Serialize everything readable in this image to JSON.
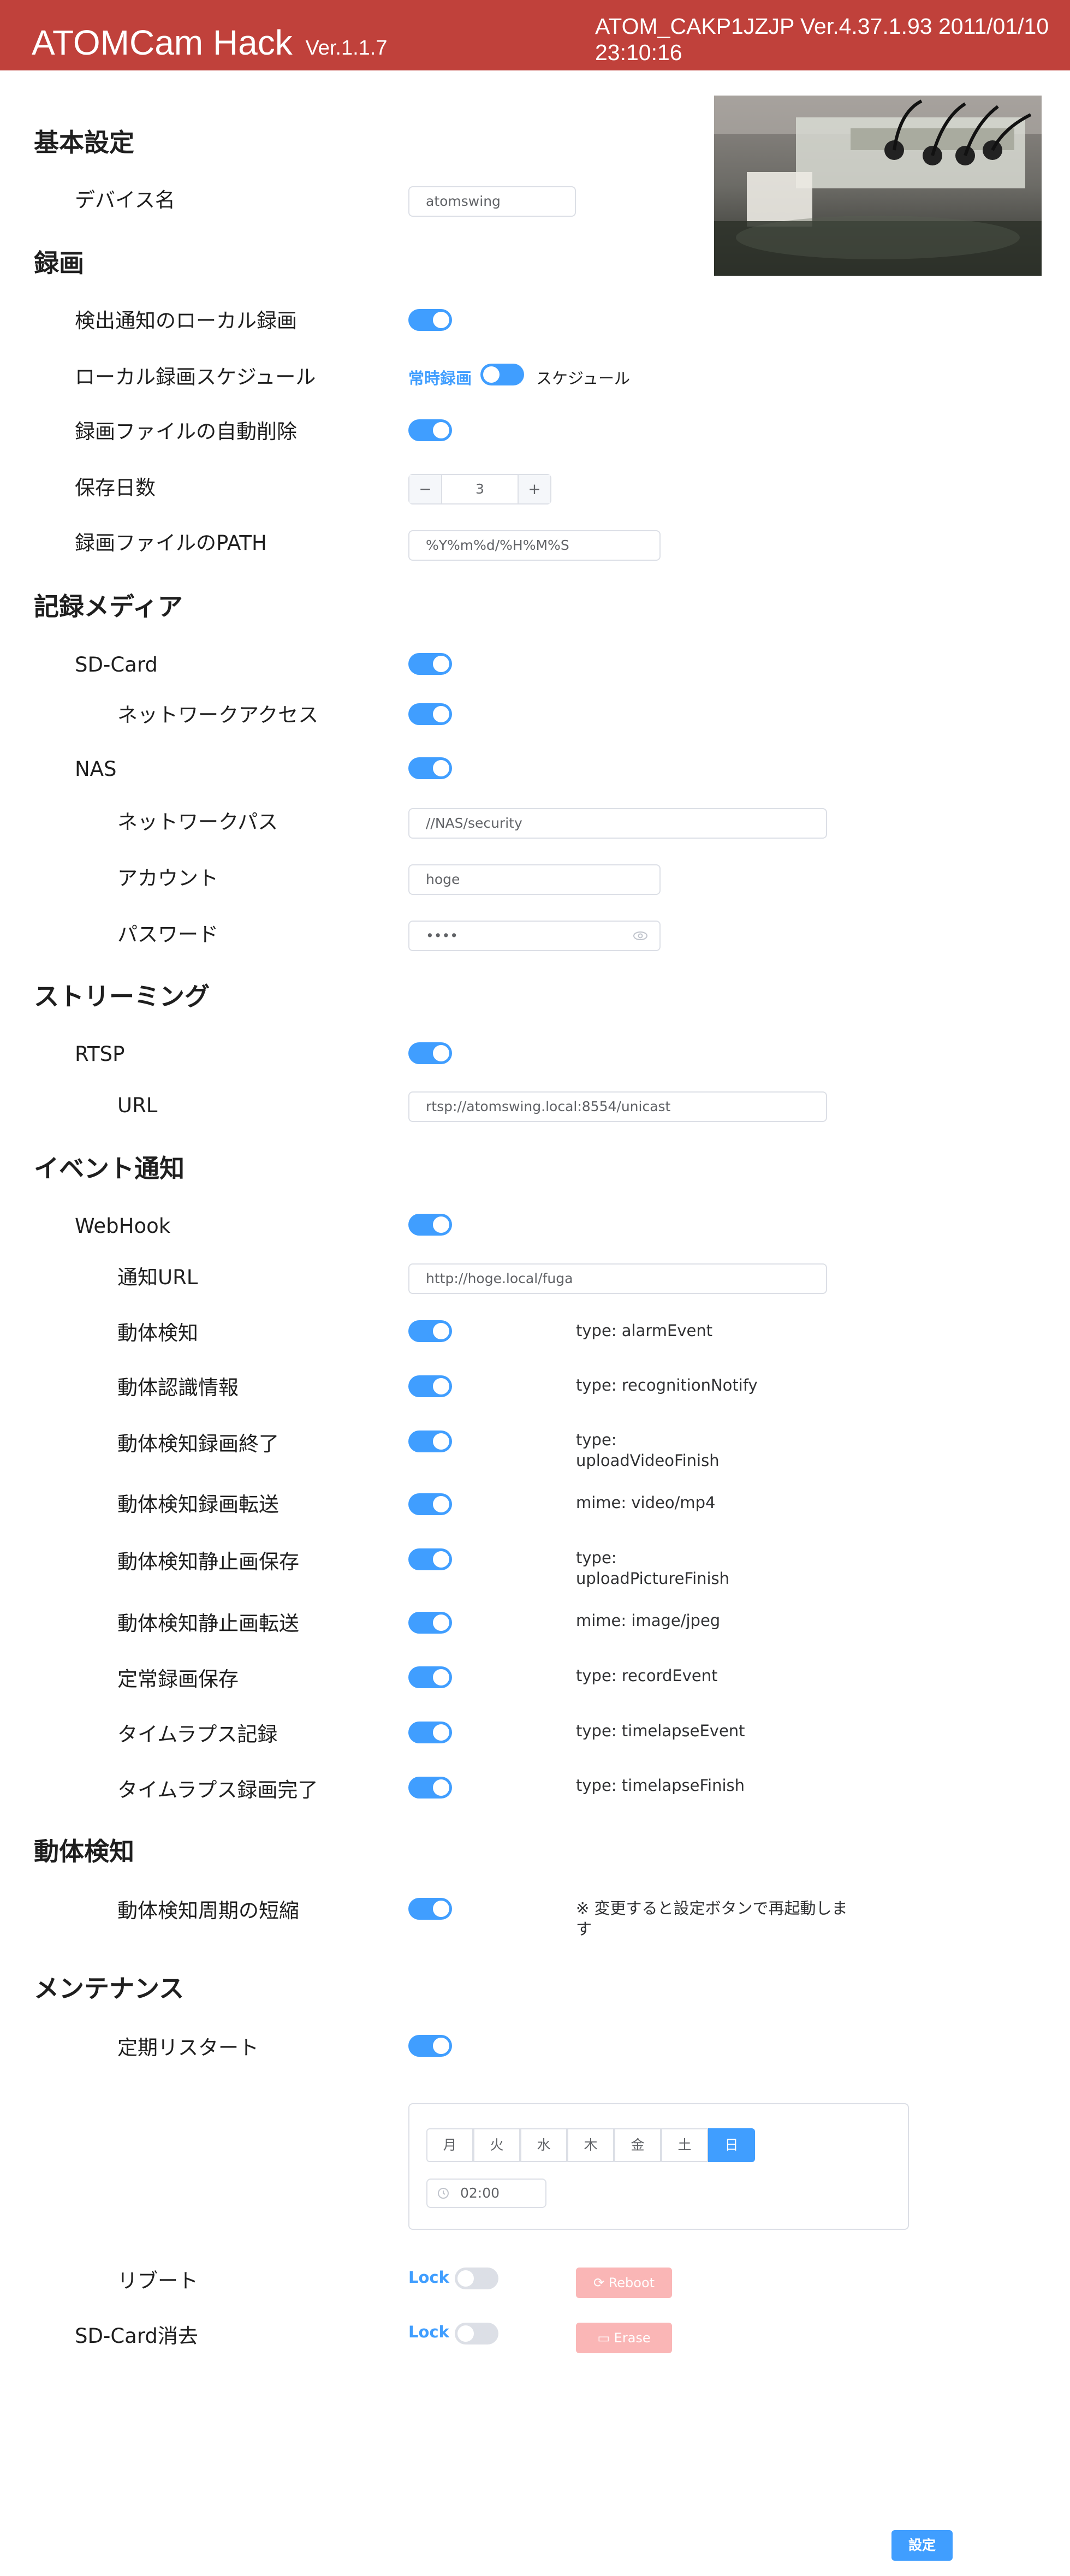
{
  "header": {
    "title": "ATOMCam Hack",
    "version": "Ver.1.1.7",
    "device_info": "ATOM_CAKP1JZJP Ver.4.37.1.93 2011/01/10 23:10:16"
  },
  "basic": {
    "section": "基本設定",
    "device_name_label": "デバイス名",
    "device_name_value": "atomswing"
  },
  "recording": {
    "section": "録画",
    "detect_local_label": "検出通知のローカル録画",
    "schedule_label": "ローカル録画スケジュール",
    "always_label": "常時録画",
    "schedule_option": "スケジュール",
    "auto_delete_label": "録画ファイルの自動削除",
    "keep_days_label": "保存日数",
    "keep_days_value": "3",
    "minus": "−",
    "plus": "+",
    "path_label": "録画ファイルのPATH",
    "path_value": "%Y%m%d/%H%M%S"
  },
  "media": {
    "section": "記録メディア",
    "sdcard_label": "SD-Card",
    "network_access_label": "ネットワークアクセス",
    "nas_label": "NAS",
    "network_path_label": "ネットワークパス",
    "network_path_value": "//NAS/security",
    "account_label": "アカウント",
    "account_value": "hoge",
    "password_label": "パスワード",
    "password_value": "••••"
  },
  "streaming": {
    "section": "ストリーミング",
    "rtsp_label": "RTSP",
    "url_label": "URL",
    "url_value": "rtsp://atomswing.local:8554/unicast"
  },
  "events": {
    "section": "イベント通知",
    "webhook_label": "WebHook",
    "notify_url_label": "通知URL",
    "notify_url_value": "http://hoge.local/fuga",
    "items": [
      {
        "label": "動体検知",
        "type": "type: alarmEvent"
      },
      {
        "label": "動体認識情報",
        "type": "type: recognitionNotify"
      },
      {
        "label": "動体検知録画終了",
        "type": "type:\nuploadVideoFinish"
      },
      {
        "label": "動体検知録画転送",
        "type": "mime: video/mp4"
      },
      {
        "label": "動体検知静止画保存",
        "type": "type:\nuploadPictureFinish"
      },
      {
        "label": "動体検知静止画転送",
        "type": "mime: image/jpeg"
      },
      {
        "label": "定常録画保存",
        "type": "type: recordEvent"
      },
      {
        "label": "タイムラプス記録",
        "type": "type: timelapseEvent"
      },
      {
        "label": "タイムラプス録画完了",
        "type": "type: timelapseFinish"
      }
    ]
  },
  "motion": {
    "section": "動体検知",
    "shorten_label": "動体検知周期の短縮",
    "note": "※ 変更すると設定ボタンで再起動します"
  },
  "maintenance": {
    "section": "メンテナンス",
    "restart_label": "定期リスタート",
    "days": [
      "月",
      "火",
      "水",
      "木",
      "金",
      "土",
      "日"
    ],
    "selected_day": "日",
    "time_value": "02:00",
    "reboot_label": "リブート",
    "lock_label": "Lock",
    "reboot_button": "Reboot",
    "erase_label": "SD-Card消去",
    "erase_button": "Erase"
  },
  "footer": {
    "save_button": "設定"
  },
  "colors": {
    "header_bg": "#c0413b",
    "accent": "#409eff",
    "danger_light": "#fab6b6"
  }
}
